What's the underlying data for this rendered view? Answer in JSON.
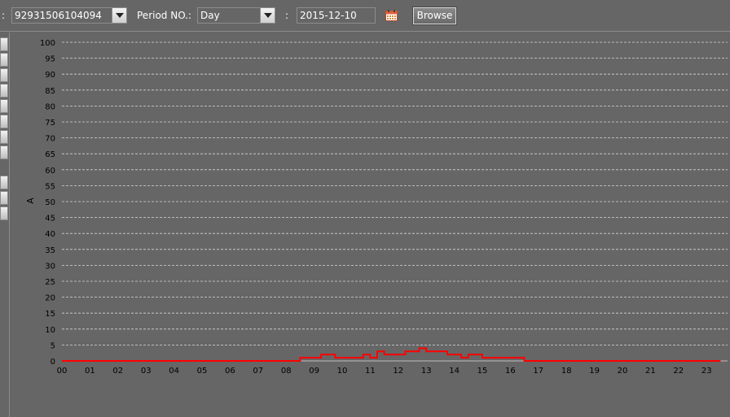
{
  "toolbar": {
    "label_lead_colon": ":",
    "device_select": {
      "value": "92931506104094"
    },
    "period_label": "Period NO.:",
    "period_select": {
      "value": "Day"
    },
    "date_colon": ":",
    "date_value": "2015-12-10",
    "calendar_icon": "calendar-icon",
    "browse_label": "Browse"
  },
  "colors": {
    "background": "#666666",
    "series": "#ff0000",
    "grid": "#d8d8d8"
  },
  "chart_data": {
    "type": "line",
    "title": "",
    "ylabel": "A",
    "xlabel": "",
    "ylim": [
      0,
      100
    ],
    "yticks": [
      "0",
      "5",
      "10",
      "15",
      "20",
      "25",
      "30",
      "35",
      "40",
      "45",
      "50",
      "55",
      "60",
      "65",
      "70",
      "75",
      "80",
      "85",
      "90",
      "95",
      "100"
    ],
    "xlim": [
      0,
      23.5
    ],
    "xticks": [
      "00",
      "01",
      "02",
      "03",
      "04",
      "05",
      "06",
      "07",
      "08",
      "09",
      "10",
      "11",
      "12",
      "13",
      "14",
      "15",
      "16",
      "17",
      "18",
      "19",
      "20",
      "21",
      "22",
      "23"
    ],
    "grid": "horizontal-dashed",
    "series": [
      {
        "step": true,
        "points": [
          [
            0,
            0
          ],
          [
            8.5,
            0
          ],
          [
            8.5,
            1
          ],
          [
            9.25,
            1
          ],
          [
            9.25,
            2
          ],
          [
            9.75,
            2
          ],
          [
            9.75,
            1
          ],
          [
            10.75,
            1
          ],
          [
            10.75,
            2
          ],
          [
            11.0,
            2
          ],
          [
            11.0,
            1
          ],
          [
            11.25,
            1
          ],
          [
            11.25,
            3
          ],
          [
            11.5,
            3
          ],
          [
            11.5,
            2
          ],
          [
            12.25,
            2
          ],
          [
            12.25,
            3
          ],
          [
            12.75,
            3
          ],
          [
            12.75,
            4
          ],
          [
            13.0,
            4
          ],
          [
            13.0,
            3
          ],
          [
            13.75,
            3
          ],
          [
            13.75,
            2
          ],
          [
            14.25,
            2
          ],
          [
            14.25,
            1
          ],
          [
            14.5,
            1
          ],
          [
            14.5,
            2
          ],
          [
            15.0,
            2
          ],
          [
            15.0,
            1
          ],
          [
            16.5,
            1
          ],
          [
            16.5,
            0
          ],
          [
            23.5,
            0
          ]
        ]
      }
    ]
  }
}
